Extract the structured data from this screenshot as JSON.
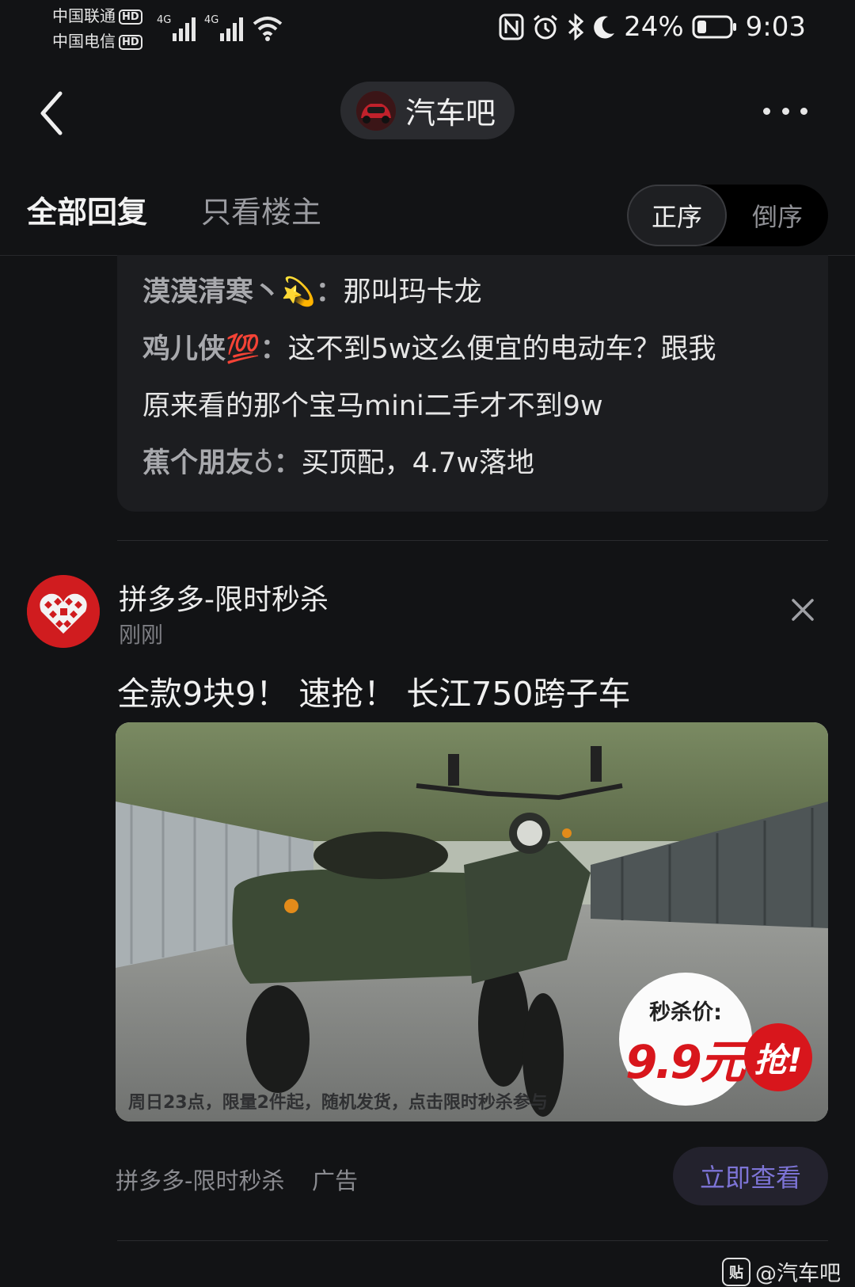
{
  "status_bar": {
    "carrier1": "中国联通",
    "carrier2": "中国电信",
    "hd": "HD",
    "net": "4G",
    "battery": "24%",
    "time": "9:03"
  },
  "nav": {
    "forum_name": "汽车吧"
  },
  "tabs": {
    "all": "全部回复",
    "op_only": "只看楼主",
    "sort_asc": "正序",
    "sort_desc": "倒序"
  },
  "sub_replies": [
    {
      "user": "漠漠清寒丶💫",
      "sep": "：",
      "text": "那叫玛卡龙"
    },
    {
      "user": "鸡儿侠💯",
      "sep": "：",
      "text": "这不到5w这么便宜的电动车？跟我"
    },
    {
      "user": "",
      "sep": "",
      "text": "原来看的那个宝马mini二手才不到9w"
    },
    {
      "user": "蕉个朋友♁",
      "sep": "：",
      "text": "买顶配，4.7w落地"
    }
  ],
  "ad": {
    "name": "拼多多-限时秒杀",
    "time": "刚刚",
    "title": "全款9块9！ 速抢！ 长江750跨子车",
    "image_caption": "周日23点，限量2件起，随机发货，点击限时秒杀参与",
    "price_label": "秒杀价:",
    "price_value": "9.9元",
    "grab": "抢!",
    "source": "拼多多-限时秒杀",
    "ad_label": "广告",
    "cta": "立即查看"
  },
  "watermark": {
    "icon": "贴",
    "text": "@汽车吧"
  }
}
